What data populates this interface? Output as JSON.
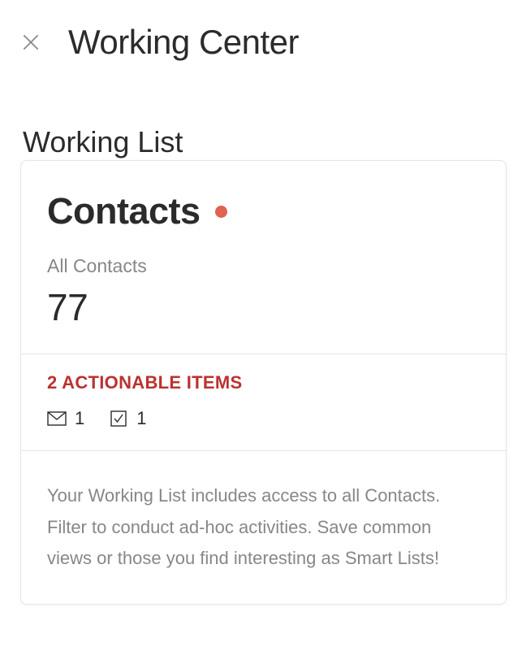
{
  "header": {
    "title": "Working Center"
  },
  "section_label": "Working List",
  "card": {
    "title": "Contacts",
    "status_dot_color": "#e0624f",
    "subheading": "All Contacts",
    "count": "77",
    "action_heading": "2 ACTIONABLE ITEMS",
    "stats": {
      "mail_count": "1",
      "task_count": "1"
    },
    "description": "Your Working List includes access to all Contacts. Filter to conduct ad-hoc activities. Save common views or those you find interesting as Smart Lists!"
  }
}
